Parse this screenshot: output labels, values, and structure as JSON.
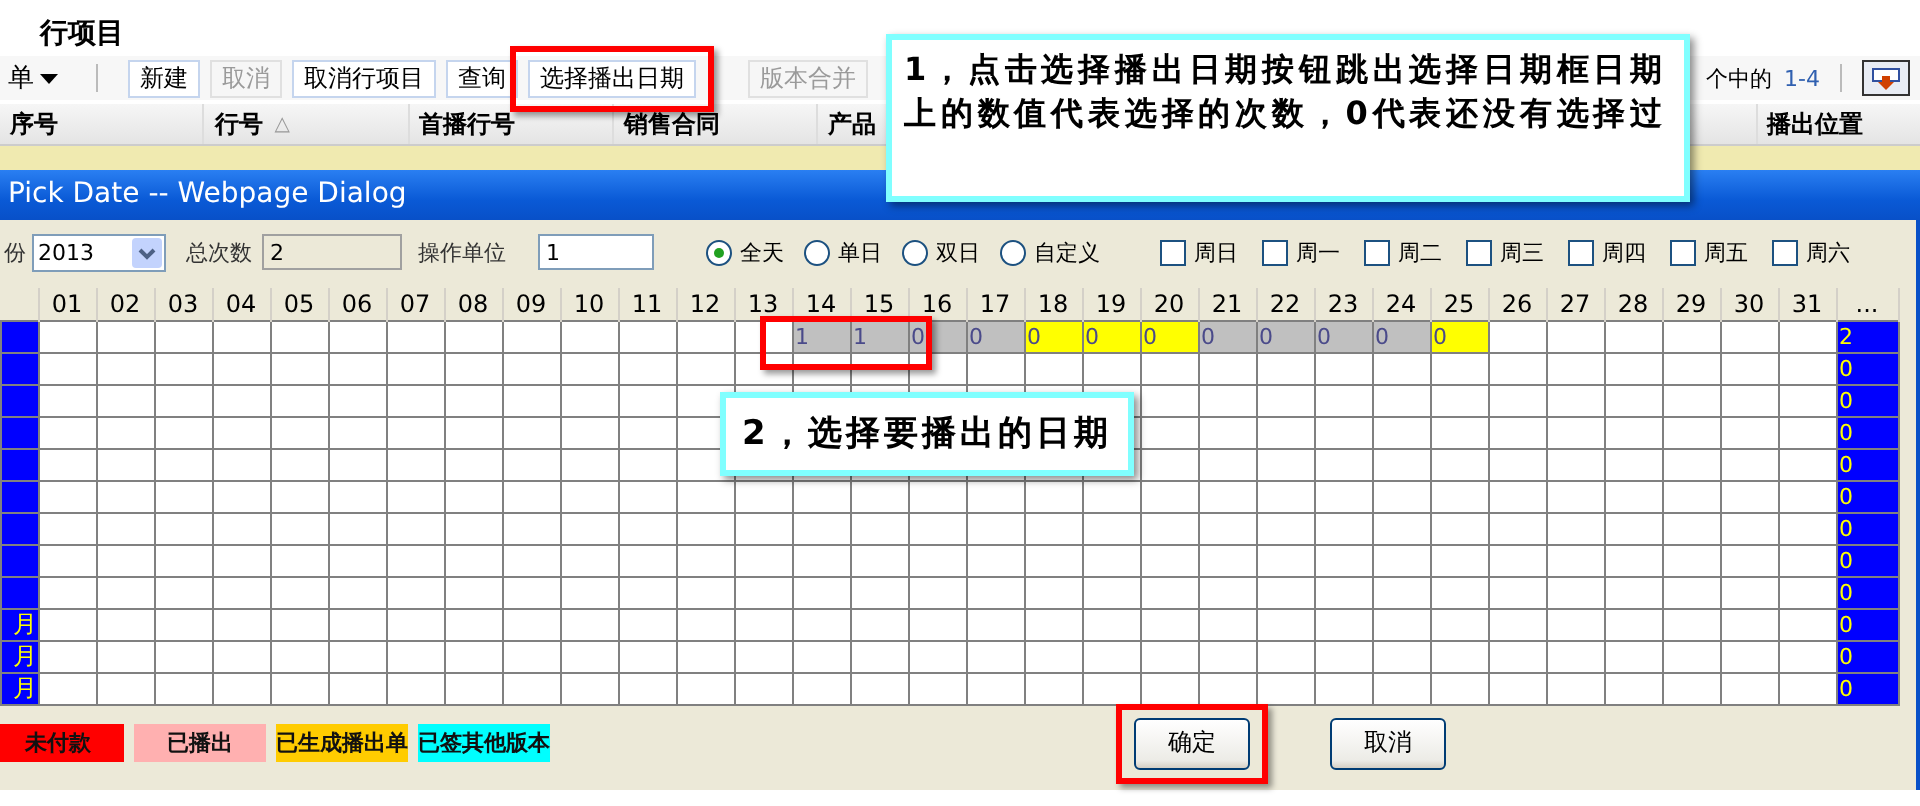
{
  "page": {
    "title": "行项目",
    "toolbar": [
      {
        "label": "单",
        "kind": "menu",
        "disabled": false,
        "highlighted": false
      },
      {
        "label": "新建",
        "kind": "button",
        "disabled": false,
        "highlighted": false
      },
      {
        "label": "取消",
        "kind": "button",
        "disabled": true,
        "highlighted": false
      },
      {
        "label": "取消行项目",
        "kind": "button",
        "disabled": false,
        "highlighted": false
      },
      {
        "label": "查询",
        "kind": "button",
        "disabled": false,
        "highlighted": false
      },
      {
        "label": "选择播出日期",
        "kind": "button",
        "disabled": false,
        "highlighted": true
      },
      {
        "label": "版本合并",
        "kind": "button",
        "disabled": true,
        "highlighted": false
      }
    ],
    "pager_label": "个中的",
    "pager_range": "1-4",
    "columns": [
      {
        "label": "序号"
      },
      {
        "label": "行号",
        "sort_mark": "△"
      },
      {
        "label": "首播行号"
      },
      {
        "label": "销售合同"
      },
      {
        "label": "产品"
      },
      {
        "label": "播出位置"
      }
    ]
  },
  "dialog": {
    "title": "Pick Date -- Webpage Dialog",
    "year_label": "份",
    "year": "2013",
    "total_label": "总次数",
    "total": "2",
    "unit_label": "操作单位",
    "unit": "1",
    "modes": [
      {
        "label": "全天",
        "selected": true
      },
      {
        "label": "单日",
        "selected": false
      },
      {
        "label": "双日",
        "selected": false
      },
      {
        "label": "自定义",
        "selected": false
      }
    ],
    "weekdays": [
      {
        "label": "周日",
        "checked": false
      },
      {
        "label": "周一",
        "checked": false
      },
      {
        "label": "周二",
        "checked": false
      },
      {
        "label": "周三",
        "checked": false
      },
      {
        "label": "周四",
        "checked": false
      },
      {
        "label": "周五",
        "checked": false
      },
      {
        "label": "周六",
        "checked": false
      }
    ],
    "columns": [
      "01",
      "02",
      "03",
      "04",
      "05",
      "06",
      "07",
      "08",
      "09",
      "10",
      "11",
      "12",
      "13",
      "14",
      "15",
      "16",
      "17",
      "18",
      "19",
      "20",
      "21",
      "22",
      "23",
      "24",
      "25",
      "26",
      "27",
      "28",
      "29",
      "30",
      "31",
      "..."
    ],
    "rows": [
      {
        "total": "2",
        "cells": [
          null,
          null,
          null,
          null,
          null,
          null,
          null,
          null,
          null,
          null,
          null,
          null,
          null,
          {
            "value": "1",
            "color": "#c0c0c0",
            "highlighted": true
          },
          {
            "value": "1",
            "color": "#c0c0c0",
            "highlighted": true
          },
          {
            "value": "0",
            "color": "#c0c0c0",
            "highlighted": false
          },
          {
            "value": "0",
            "color": "#c0c0c0",
            "highlighted": false
          },
          {
            "value": "0",
            "color": "#ffff00",
            "highlighted": false
          },
          {
            "value": "0",
            "color": "#ffff00",
            "highlighted": false
          },
          {
            "value": "0",
            "color": "#ffff00",
            "highlighted": false
          },
          {
            "value": "0",
            "color": "#c0c0c0",
            "highlighted": false
          },
          {
            "value": "0",
            "color": "#c0c0c0",
            "highlighted": false
          },
          {
            "value": "0",
            "color": "#c0c0c0",
            "highlighted": false
          },
          {
            "value": "0",
            "color": "#c0c0c0",
            "highlighted": false
          },
          {
            "value": "0",
            "color": "#ffff00",
            "highlighted": false
          },
          null,
          null,
          null,
          null,
          null,
          null
        ]
      },
      {
        "total": "0"
      },
      {
        "total": "0"
      },
      {
        "total": "0"
      },
      {
        "total": "0"
      },
      {
        "total": "0"
      },
      {
        "total": "0"
      },
      {
        "total": "0"
      },
      {
        "total": "0"
      },
      {
        "label": "月",
        "total": "0"
      },
      {
        "label": "月",
        "total": "0"
      },
      {
        "label": "月",
        "total": "0"
      }
    ],
    "legend": [
      {
        "label": "未付款",
        "color": "#ff0000"
      },
      {
        "label": "已播出",
        "color": "#ffb0b0"
      },
      {
        "label": "已生成播出单",
        "color": "#ffcc00"
      },
      {
        "label": "已签其他版本",
        "color": "#00ffff"
      }
    ],
    "buttons": [
      {
        "label": "确定",
        "highlighted": true
      },
      {
        "label": "取消",
        "highlighted": false
      }
    ]
  },
  "callouts": [
    {
      "text": "1，点击选择播出日期按钮跳出选择日期框日期上的数值代表选择的次数，0代表还没有选择过"
    },
    {
      "text": "2，选择要播出的日期"
    }
  ]
}
